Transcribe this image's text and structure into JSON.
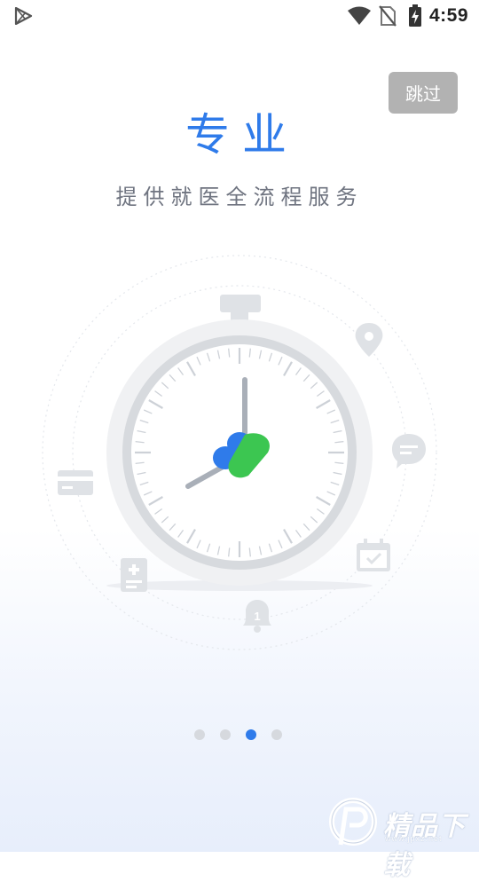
{
  "status_bar": {
    "time": "4:59",
    "icons": [
      "play-store-icon",
      "wifi-icon",
      "no-sim-icon",
      "battery-charging-icon"
    ]
  },
  "skip_button": {
    "label": "跳过"
  },
  "intro": {
    "title": "专业",
    "subtitle": "提供就医全流程服务"
  },
  "illustration": {
    "icons": [
      "location-pin-icon",
      "chat-bubble-icon",
      "calendar-check-icon",
      "bell-icon",
      "medical-record-icon",
      "card-icon",
      "stopwatch-icon",
      "app-logo-icon"
    ],
    "bell_badge": "1"
  },
  "pager": {
    "total": 4,
    "active_index": 2
  },
  "watermark": {
    "text": "精品下载",
    "url": "www.jpxz.net"
  },
  "colors": {
    "accent_blue": "#2f7bea",
    "logo_green": "#3cc651",
    "skip_bg": "#b2b2b2"
  }
}
